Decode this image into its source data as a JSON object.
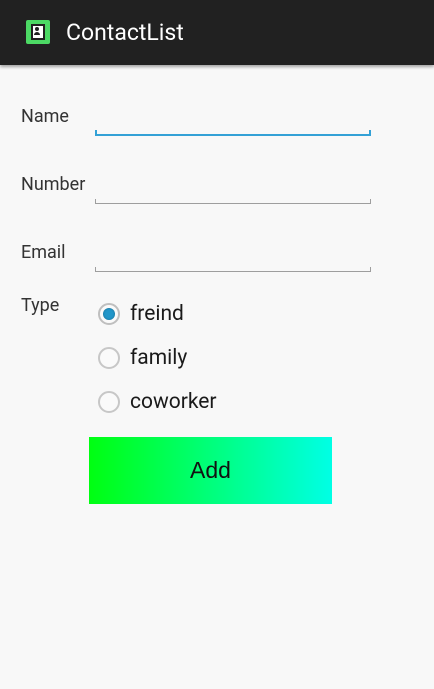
{
  "app": {
    "title": "ContactList",
    "icon": "contact-card-icon",
    "accent_color": "#33a1d6",
    "bar_color": "#212121"
  },
  "form": {
    "fields": [
      {
        "label": "Name",
        "value": "",
        "placeholder": "",
        "focused": true
      },
      {
        "label": "Number",
        "value": "",
        "placeholder": "",
        "focused": false
      },
      {
        "label": "Email",
        "value": "",
        "placeholder": "",
        "focused": false
      }
    ],
    "type_label": "Type",
    "type_options": [
      {
        "label": "freind",
        "checked": true
      },
      {
        "label": "family",
        "checked": false
      },
      {
        "label": "coworker",
        "checked": false
      }
    ],
    "submit_label": "Add",
    "submit_gradient": [
      "#00ff11",
      "#00ffe5"
    ]
  }
}
